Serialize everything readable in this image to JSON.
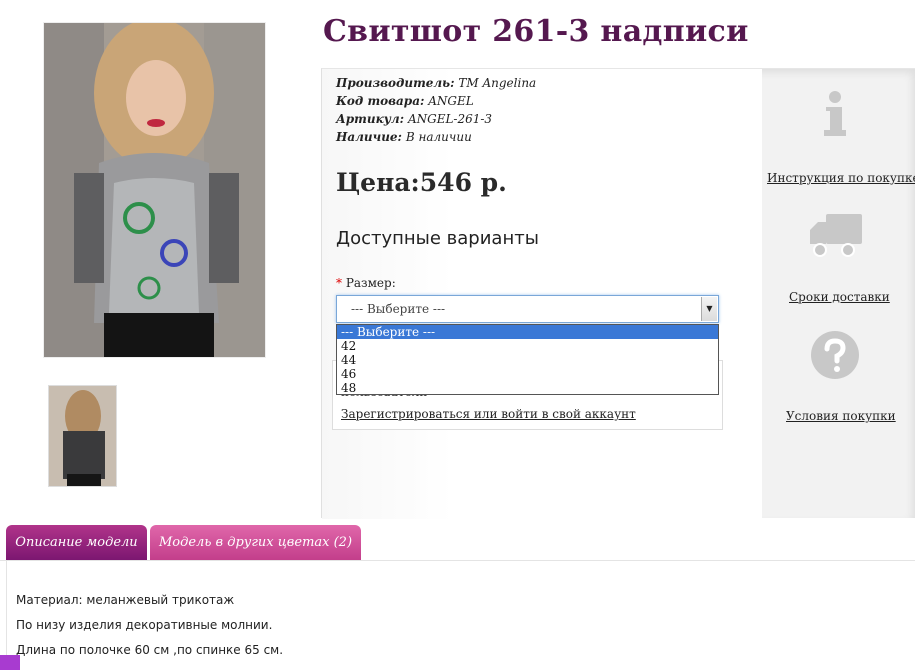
{
  "product": {
    "title": "Свитшот 261-3 надписи",
    "meta": [
      {
        "key": "Производитель:",
        "value": "ТМ Angelina"
      },
      {
        "key": "Код товара:",
        "value": "ANGEL"
      },
      {
        "key": "Артикул:",
        "value": "ANGEL-261-3"
      },
      {
        "key": "Наличие:",
        "value": "В наличии"
      }
    ],
    "price": "Цена:546 р.",
    "variants_title": "Доступные варианты",
    "size_required_mark": "*",
    "size_label": "Размер:",
    "size_select_value": "--- Выберите ---",
    "size_options": [
      "--- Выберите ---",
      "42",
      "44",
      "46",
      "48"
    ],
    "login_note": "пользователи",
    "login_link": "Зарегистрироваться или войти в свой аккаунт"
  },
  "side": {
    "instruction": "Инструкция по покупке",
    "delivery": "Сроки доставки",
    "terms": "Условия покупки"
  },
  "tabs": [
    "Описание модели",
    "Модель в других цветах (2)"
  ],
  "description": [
    "Материал: меланжевый трикотаж",
    "По низу изделия декоративные молнии.",
    "Длина по полочке 60 см ,по спинке 65 см."
  ],
  "colors": {
    "title": "#55184f",
    "tab_active": "#8a1c78",
    "tab_inactive": "#cf4e96",
    "select_highlight": "#3a78d6",
    "icon_gray": "#c8c8c8"
  },
  "icons": {
    "instruction": "info-icon",
    "delivery": "truck-icon",
    "terms": "question-icon",
    "select_arrow": "chevron-down-icon"
  }
}
